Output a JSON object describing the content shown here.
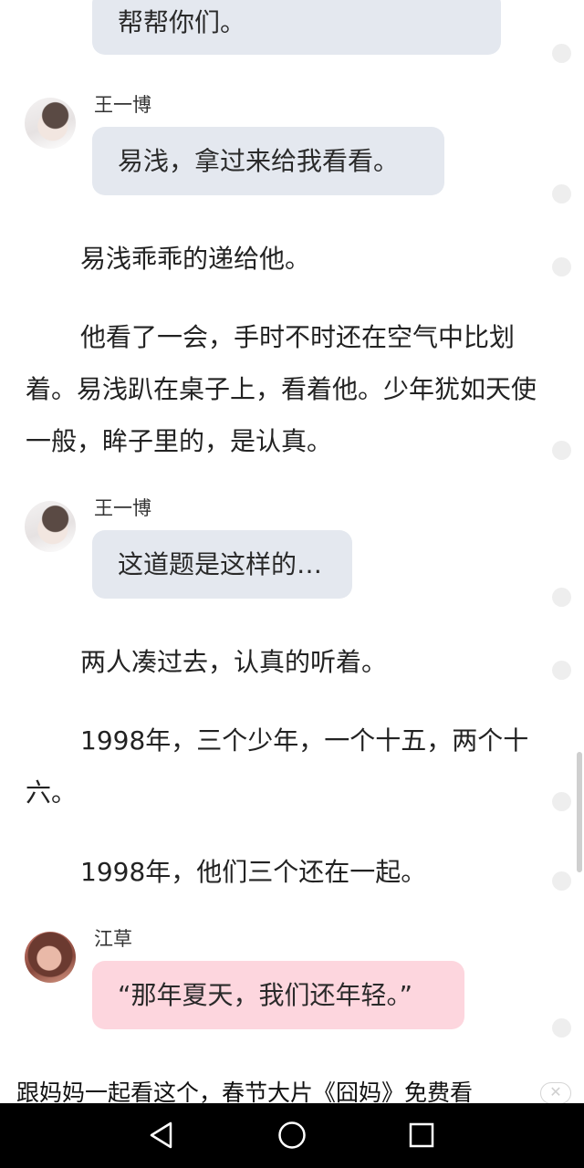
{
  "messages": {
    "top_partial": {
      "text": "帮帮你们。"
    },
    "m1": {
      "speaker": "王一博",
      "text": "易浅，拿过来给我看看。"
    },
    "m2": {
      "speaker": "王一博",
      "text": "这道题是这样的…"
    },
    "m3": {
      "speaker": "江草",
      "text": "“那年夏天，我们还年轻。”"
    }
  },
  "paragraphs": {
    "p1": "易浅乖乖的递给他。",
    "p2": "他看了一会，手时不时还在空气中比划着。易浅趴在桌子上，看着他。少年犹如天使一般，眸子里的，是认真。",
    "p3": "两人凑过去，认真的听着。",
    "p4": "1998年，三个少年，一个十五，两个十六。",
    "p5": "1998年，他们三个还在一起。"
  },
  "ad": {
    "text": "跟妈妈一起看这个，春节大片《囧妈》免费看",
    "close_label": "✕"
  },
  "navbar": {
    "back_icon": "back-triangle-icon",
    "home_icon": "home-circle-icon",
    "recents_icon": "recents-square-icon"
  },
  "colors": {
    "bubble_gray": "#e4e8ef",
    "bubble_pink": "#fdd6de",
    "navbar": "#000000"
  }
}
